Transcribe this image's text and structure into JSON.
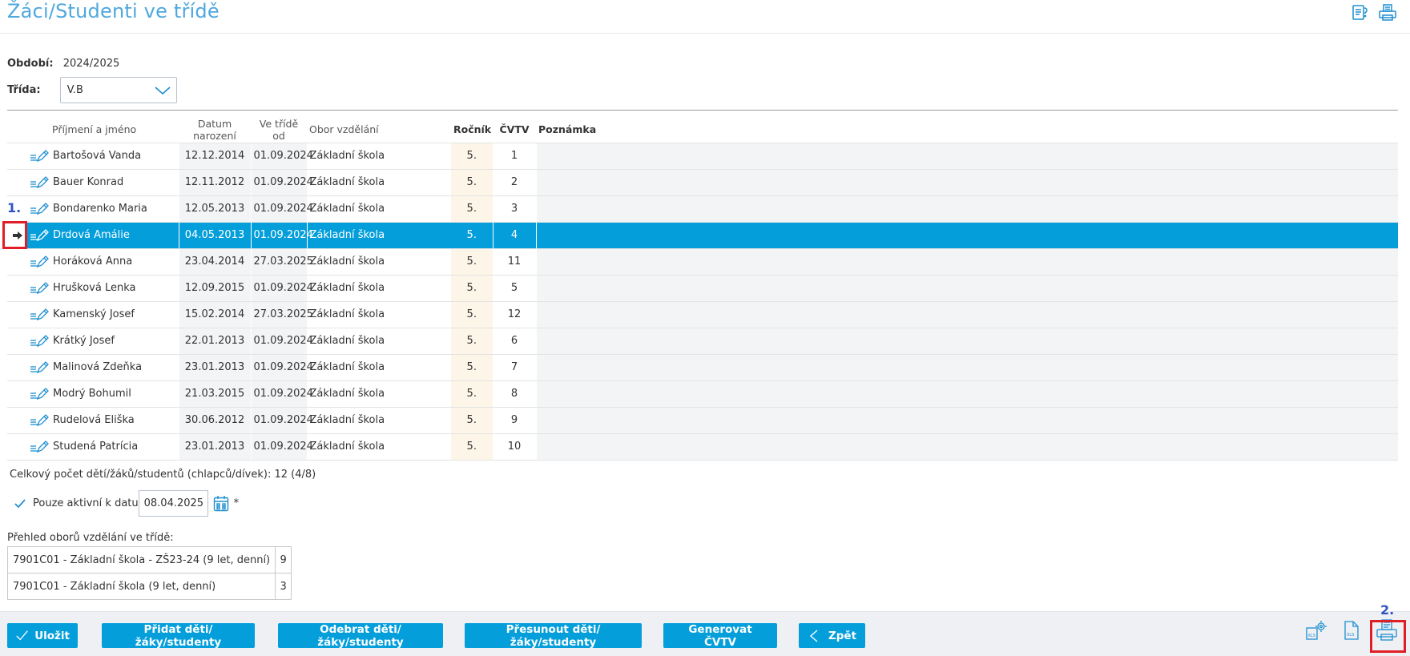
{
  "header": {
    "title": "Žáci/Studenti ve třídě",
    "icons": [
      "help-doc-icon",
      "print-icon"
    ]
  },
  "filters": {
    "period_label": "Období:",
    "period_value": "2024/2025",
    "class_label": "Třída:",
    "class_value": "V.B"
  },
  "table": {
    "columns": [
      "",
      "",
      "Příjmení a jméno",
      "Datum narození",
      "Ve třídě od",
      "Obor vzdělání",
      "Ročník",
      "ČVTV",
      "Poznámka"
    ],
    "selected_index": 3,
    "rows": [
      {
        "name": "Bartošová Vanda",
        "birth": "12.12.2014",
        "since": "01.09.2024",
        "field": "Základní škola",
        "grade": "5.",
        "cvtv": "1",
        "note": ""
      },
      {
        "name": "Bauer Konrad",
        "birth": "12.11.2012",
        "since": "01.09.2024",
        "field": "Základní škola",
        "grade": "5.",
        "cvtv": "2",
        "note": ""
      },
      {
        "name": "Bondarenko Maria",
        "birth": "12.05.2013",
        "since": "01.09.2024",
        "field": "Základní škola",
        "grade": "5.",
        "cvtv": "3",
        "note": ""
      },
      {
        "name": "Drdová Amálie",
        "birth": "04.05.2013",
        "since": "01.09.2024",
        "field": "Základní škola",
        "grade": "5.",
        "cvtv": "4",
        "note": ""
      },
      {
        "name": "Horáková Anna",
        "birth": "23.04.2014",
        "since": "27.03.2025",
        "field": "Základní škola",
        "grade": "5.",
        "cvtv": "11",
        "note": ""
      },
      {
        "name": "Hrušková Lenka",
        "birth": "12.09.2015",
        "since": "01.09.2024",
        "field": "Základní škola",
        "grade": "5.",
        "cvtv": "5",
        "note": ""
      },
      {
        "name": "Kamenský Josef",
        "birth": "15.02.2014",
        "since": "27.03.2025",
        "field": "Základní škola",
        "grade": "5.",
        "cvtv": "12",
        "note": ""
      },
      {
        "name": "Krátký Josef",
        "birth": "22.01.2013",
        "since": "01.09.2024",
        "field": "Základní škola",
        "grade": "5.",
        "cvtv": "6",
        "note": ""
      },
      {
        "name": "Malinová Zdeňka",
        "birth": "23.01.2013",
        "since": "01.09.2024",
        "field": "Základní škola",
        "grade": "5.",
        "cvtv": "7",
        "note": ""
      },
      {
        "name": "Modrý Bohumil",
        "birth": "21.03.2015",
        "since": "01.09.2024",
        "field": "Základní škola",
        "grade": "5.",
        "cvtv": "8",
        "note": ""
      },
      {
        "name": "Rudelová Eliška",
        "birth": "30.06.2012",
        "since": "01.09.2024",
        "field": "Základní škola",
        "grade": "5.",
        "cvtv": "9",
        "note": ""
      },
      {
        "name": "Studená Patrícia",
        "birth": "23.01.2013",
        "since": "01.09.2024",
        "field": "Základní škola",
        "grade": "5.",
        "cvtv": "10",
        "note": ""
      }
    ]
  },
  "summary": {
    "total_text": "Celkový počet dětí/žáků/studentů (chlapců/dívek): 12 (4/8)",
    "active_label": "Pouze aktivní k datu",
    "active_date": "08.04.2025",
    "required_mark": "*"
  },
  "overview": {
    "title": "Přehled oborů vzdělání ve třídě:",
    "rows": [
      {
        "label": "7901C01 - Základní škola - ZŠ23-24 (9 let, denní)",
        "count": "9"
      },
      {
        "label": "7901C01 - Základní škola (9 let, denní)",
        "count": "3"
      }
    ]
  },
  "callouts": {
    "one": "1.",
    "two": "2."
  },
  "footer": {
    "buttons": {
      "save": "Uložit",
      "add": "Přidat děti/žáky/studenty",
      "remove": "Odebrat děti/žáky/studenty",
      "move": "Přesunout děti/žáky/studenty",
      "generate": "Generovat ČVTV",
      "back": "Zpět"
    },
    "icons": [
      "xls-settings-icon",
      "xls-export-icon",
      "print-list-icon"
    ]
  },
  "colors": {
    "accent": "#049fdb",
    "title": "#4fa8de",
    "callout_border": "#e01e26",
    "callout_number": "#2d54c2"
  }
}
